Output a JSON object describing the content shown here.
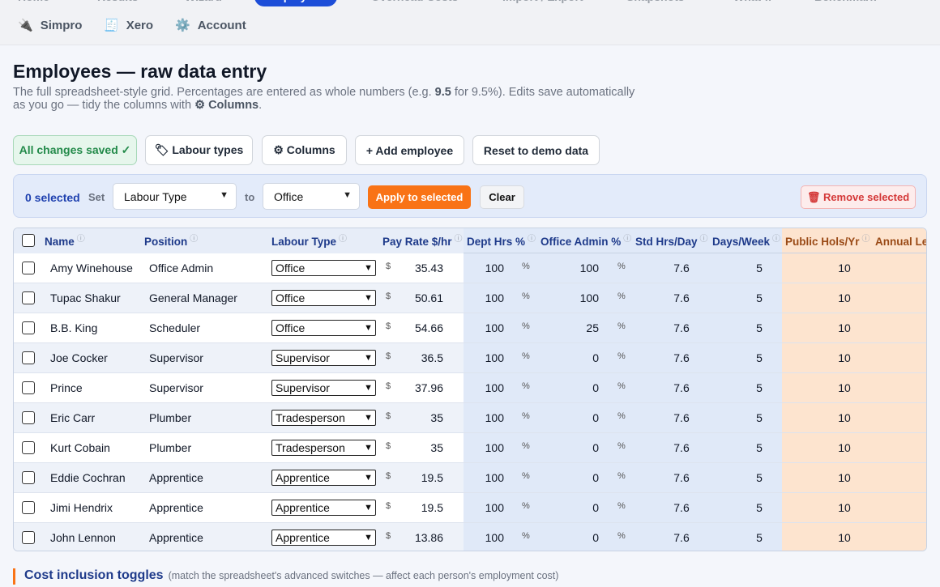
{
  "nav_top": [
    {
      "label": "Home",
      "icon": "home-icon"
    },
    {
      "label": "Results",
      "icon": "chart-icon"
    },
    {
      "label": "Wizard",
      "icon": "wand-icon"
    },
    {
      "label": "Employees",
      "icon": "people-icon",
      "active": true
    },
    {
      "label": "Overhead Costs",
      "icon": "building-icon"
    },
    {
      "label": "Import / Export",
      "icon": "transfer-icon"
    },
    {
      "label": "Snapshots",
      "icon": "camera-icon"
    },
    {
      "label": "What-if",
      "icon": "bulb-icon"
    },
    {
      "label": "Benchmark",
      "icon": "benchmark-icon"
    }
  ],
  "nav_second": [
    {
      "label": "Simpro",
      "icon": "plug-icon",
      "glyph": "🔌"
    },
    {
      "label": "Xero",
      "icon": "document-icon",
      "glyph": "🧾"
    },
    {
      "label": "Account",
      "icon": "gear-icon",
      "glyph": "⚙️"
    }
  ],
  "page": {
    "title": "Employees — raw data entry",
    "desc_pre": "The full spreadsheet-style grid. Percentages are entered as whole numbers (e.g. ",
    "desc_bold": "9.5",
    "desc_mid": " for 9.5%). Edits save automatically as you go — tidy the columns with ",
    "desc_bold2": "⚙ Columns",
    "desc_end": "."
  },
  "toolbar": {
    "saved": "All changes saved ✓",
    "labour_types": "🏷 Labour types",
    "columns": "⚙ Columns",
    "add_employee": "+ Add employee",
    "reset": "Reset to demo data"
  },
  "bulk": {
    "selected": "0 selected",
    "set": "Set",
    "field": "Labour Type",
    "to": "to",
    "value": "Office",
    "apply": "Apply to selected",
    "clear": "Clear",
    "remove": "🗑 Remove selected"
  },
  "columns": [
    "Name",
    "Position",
    "Labour Type",
    "Pay Rate $/hr",
    "Dept Hrs %",
    "Office Admin %",
    "Std Hrs/Day",
    "Days/Week",
    "Public Hols/Yr",
    "Annual Leave"
  ],
  "units": {
    "currency": "$",
    "percent": "%"
  },
  "employees": [
    {
      "name": "Amy Winehouse",
      "position": "Office Admin",
      "labour": "Office",
      "pay": "35.43",
      "dept": "100",
      "admin": "100",
      "hrs": "7.6",
      "days": "5",
      "hols": "10"
    },
    {
      "name": "Tupac Shakur",
      "position": "General Manager",
      "labour": "Office",
      "pay": "50.61",
      "dept": "100",
      "admin": "100",
      "hrs": "7.6",
      "days": "5",
      "hols": "10"
    },
    {
      "name": "B.B. King",
      "position": "Scheduler",
      "labour": "Office",
      "pay": "54.66",
      "dept": "100",
      "admin": "25",
      "hrs": "7.6",
      "days": "5",
      "hols": "10"
    },
    {
      "name": "Joe Cocker",
      "position": "Supervisor",
      "labour": "Supervisor",
      "pay": "36.5",
      "dept": "100",
      "admin": "0",
      "hrs": "7.6",
      "days": "5",
      "hols": "10"
    },
    {
      "name": "Prince",
      "position": "Supervisor",
      "labour": "Supervisor",
      "pay": "37.96",
      "dept": "100",
      "admin": "0",
      "hrs": "7.6",
      "days": "5",
      "hols": "10"
    },
    {
      "name": "Eric Carr",
      "position": "Plumber",
      "labour": "Tradesperson",
      "pay": "35",
      "dept": "100",
      "admin": "0",
      "hrs": "7.6",
      "days": "5",
      "hols": "10"
    },
    {
      "name": "Kurt Cobain",
      "position": "Plumber",
      "labour": "Tradesperson",
      "pay": "35",
      "dept": "100",
      "admin": "0",
      "hrs": "7.6",
      "days": "5",
      "hols": "10"
    },
    {
      "name": "Eddie Cochran",
      "position": "Apprentice",
      "labour": "Apprentice",
      "pay": "19.5",
      "dept": "100",
      "admin": "0",
      "hrs": "7.6",
      "days": "5",
      "hols": "10"
    },
    {
      "name": "Jimi Hendrix",
      "position": "Apprentice",
      "labour": "Apprentice",
      "pay": "19.5",
      "dept": "100",
      "admin": "0",
      "hrs": "7.6",
      "days": "5",
      "hols": "10"
    },
    {
      "name": "John Lennon",
      "position": "Apprentice",
      "labour": "Apprentice",
      "pay": "13.86",
      "dept": "100",
      "admin": "0",
      "hrs": "7.6",
      "days": "5",
      "hols": "10"
    }
  ],
  "section": {
    "title": "Cost inclusion toggles",
    "note": "(match the spreadsheet's advanced switches — affect each person's employment cost)"
  }
}
